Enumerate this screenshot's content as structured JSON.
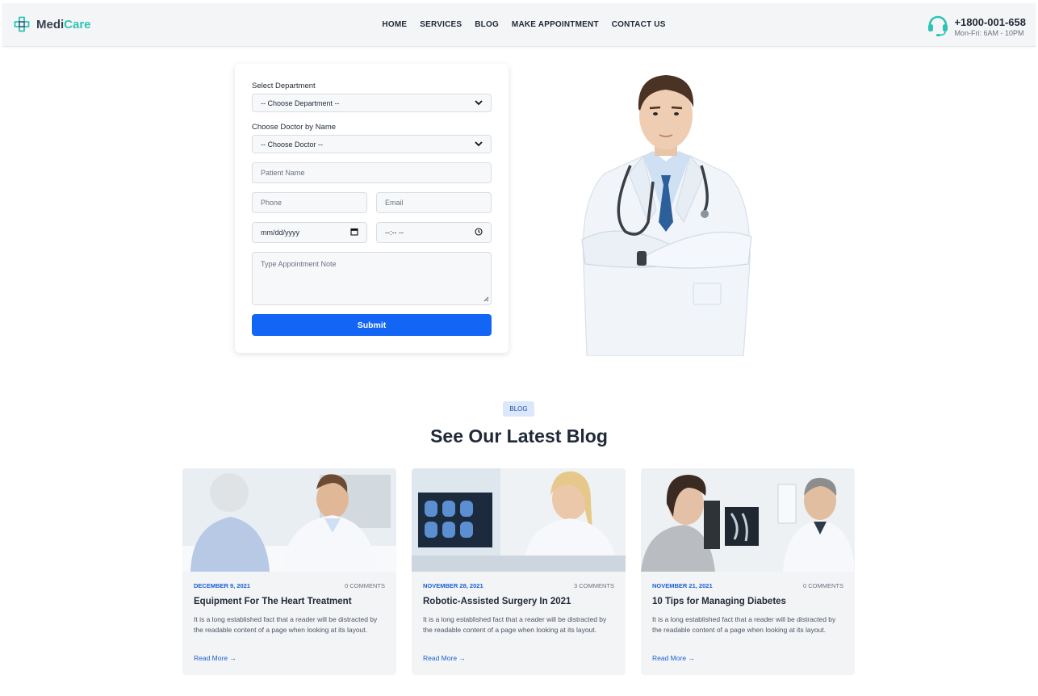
{
  "brand": {
    "name_part1": "Medi",
    "name_part2": "Care",
    "accent_color": "#2cc4b4"
  },
  "nav": {
    "items": [
      "HOME",
      "SERVICES",
      "BLOG",
      "MAKE APPOINTMENT",
      "CONTACT US"
    ]
  },
  "contact": {
    "phone": "+1800-001-658",
    "hours": "Mon-Fri: 6AM - 10PM",
    "icon": "headset-icon"
  },
  "form": {
    "department_label": "Select Department",
    "department_value": "-- Choose Department --",
    "doctor_label": "Choose Doctor by Name",
    "doctor_value": "-- Choose Doctor --",
    "patient_placeholder": "Patient Name",
    "phone_placeholder": "Phone",
    "email_placeholder": "Email",
    "date_value": "mm/dd/yyyy",
    "time_value": "--:-- --",
    "note_placeholder": "Type Appointment Note",
    "submit_label": "Submit",
    "submit_color": "#1366f5"
  },
  "blog": {
    "badge": "BLOG",
    "title": "See Our Latest Blog",
    "cards": [
      {
        "date": "DECEMBER 9, 2021",
        "comments": "0 COMMENTS",
        "title": "Equipment For The Heart Treatment",
        "excerpt": "It is a long established fact that a reader will be distracted by the readable content of a page when looking at its layout.",
        "more": "Read More →"
      },
      {
        "date": "NOVEMBER 28, 2021",
        "comments": "3 COMMENTS",
        "title": "Robotic-Assisted Surgery In 2021",
        "excerpt": "It is a long established fact that a reader will be distracted by the readable content of a page when looking at its layout.",
        "more": "Read More →"
      },
      {
        "date": "NOVEMBER 21, 2021",
        "comments": "0 COMMENTS",
        "title": "10 Tips for Managing Diabetes",
        "excerpt": "It is a long established fact that a reader will be distracted by the readable content of a page when looking at its layout.",
        "more": "Read More →"
      }
    ]
  }
}
